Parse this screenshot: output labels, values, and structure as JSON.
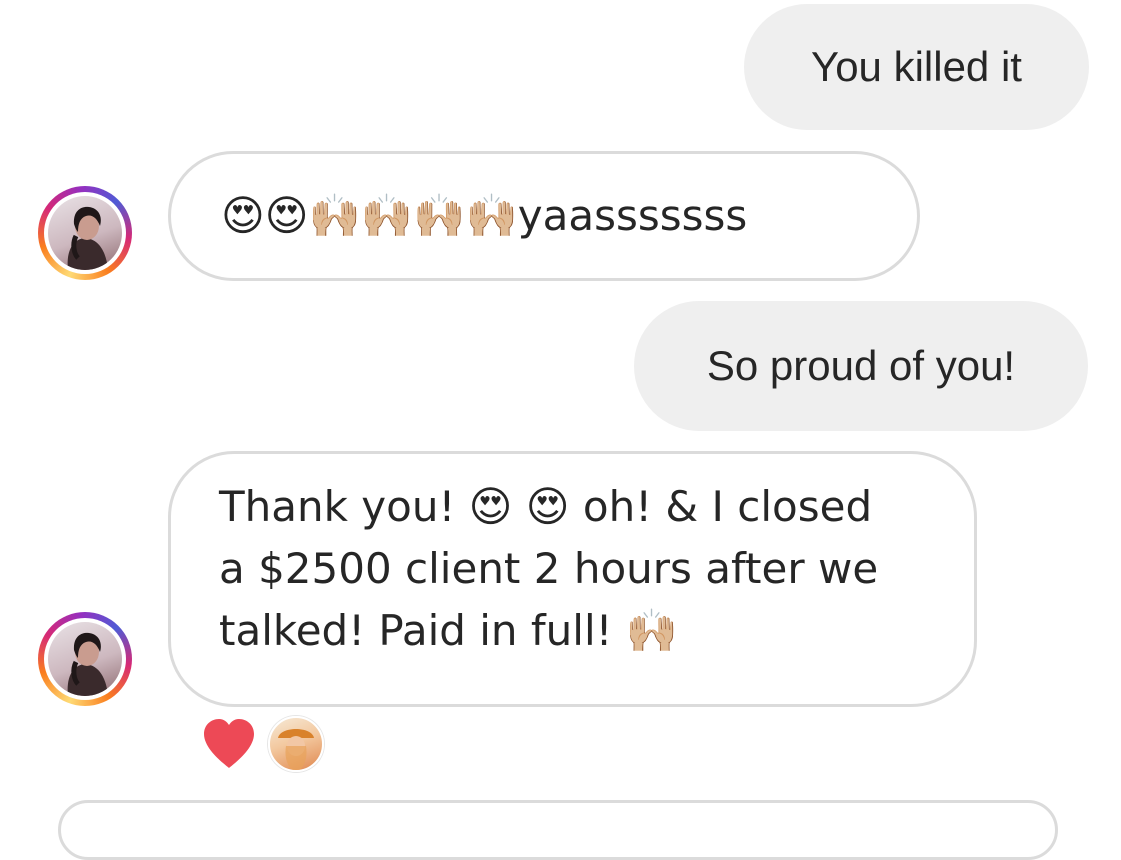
{
  "thread": {
    "messages": [
      {
        "direction": "outgoing",
        "text": "You killed it"
      },
      {
        "direction": "incoming",
        "text": "😍😍🙌🏼🙌🏼🙌🏼🙌🏼yaasssssss"
      },
      {
        "direction": "outgoing",
        "text": "So proud of you!"
      },
      {
        "direction": "incoming",
        "lines": [
          "Thank you! 😍 😍 oh! & I closed",
          "a $2500 client 2 hours after we",
          "talked! Paid in full! 🙌🏼"
        ]
      }
    ],
    "reaction": {
      "emoji": "heart-icon",
      "color": "#ed4956"
    }
  },
  "composer": {
    "placeholder": ""
  }
}
